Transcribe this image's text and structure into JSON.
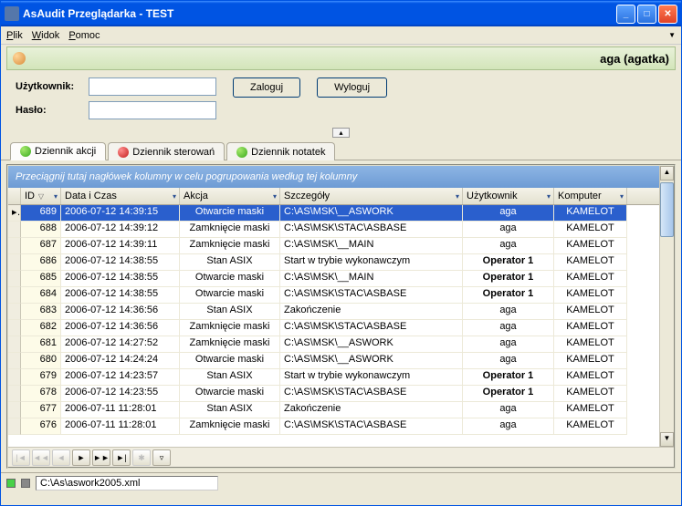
{
  "window": {
    "title": "AsAudit Przeglądarka - TEST"
  },
  "menu": {
    "file": "Plik",
    "view": "Widok",
    "help": "Pomoc"
  },
  "userbar": {
    "display": "aga (agatka)"
  },
  "login": {
    "user_label": "Użytkownik:",
    "pass_label": "Hasło:",
    "user_value": "",
    "pass_value": "",
    "login_btn": "Zaloguj",
    "logout_btn": "Wyloguj"
  },
  "tabs": {
    "actions": "Dziennik akcji",
    "controls": "Dziennik sterowań",
    "notes": "Dziennik notatek"
  },
  "grid": {
    "group_hint": "Przeciągnij tutaj nagłówek kolumny w celu pogrupowania według tej kolumny",
    "cols": {
      "id": "ID",
      "dt": "Data i Czas",
      "action": "Akcja",
      "details": "Szczegóły",
      "user": "Użytkownik",
      "computer": "Komputer"
    },
    "rows": [
      {
        "id": "689",
        "dt": "2006-07-12 14:39:15",
        "action": "Otwarcie maski",
        "details": "C:\\AS\\MSK\\__ASWORK",
        "user": "aga",
        "computer": "KAMELOT",
        "selected": true
      },
      {
        "id": "688",
        "dt": "2006-07-12 14:39:12",
        "action": "Zamknięcie maski",
        "details": "C:\\AS\\MSK\\STAC\\ASBASE",
        "user": "aga",
        "computer": "KAMELOT"
      },
      {
        "id": "687",
        "dt": "2006-07-12 14:39:11",
        "action": "Zamknięcie maski",
        "details": "C:\\AS\\MSK\\__MAIN",
        "user": "aga",
        "computer": "KAMELOT"
      },
      {
        "id": "686",
        "dt": "2006-07-12 14:38:55",
        "action": "Stan ASIX",
        "details": "Start w trybie wykonawczym",
        "user": "Operator 1",
        "ubold": true,
        "computer": "KAMELOT"
      },
      {
        "id": "685",
        "dt": "2006-07-12 14:38:55",
        "action": "Otwarcie maski",
        "details": "C:\\AS\\MSK\\__MAIN",
        "user": "Operator 1",
        "ubold": true,
        "computer": "KAMELOT"
      },
      {
        "id": "684",
        "dt": "2006-07-12 14:38:55",
        "action": "Otwarcie maski",
        "details": "C:\\AS\\MSK\\STAC\\ASBASE",
        "user": "Operator 1",
        "ubold": true,
        "computer": "KAMELOT"
      },
      {
        "id": "683",
        "dt": "2006-07-12 14:36:56",
        "action": "Stan ASIX",
        "details": "Zakończenie",
        "user": "aga",
        "computer": "KAMELOT"
      },
      {
        "id": "682",
        "dt": "2006-07-12 14:36:56",
        "action": "Zamknięcie maski",
        "details": "C:\\AS\\MSK\\STAC\\ASBASE",
        "user": "aga",
        "computer": "KAMELOT"
      },
      {
        "id": "681",
        "dt": "2006-07-12 14:27:52",
        "action": "Zamknięcie maski",
        "details": "C:\\AS\\MSK\\__ASWORK",
        "user": "aga",
        "computer": "KAMELOT"
      },
      {
        "id": "680",
        "dt": "2006-07-12 14:24:24",
        "action": "Otwarcie maski",
        "details": "C:\\AS\\MSK\\__ASWORK",
        "user": "aga",
        "computer": "KAMELOT"
      },
      {
        "id": "679",
        "dt": "2006-07-12 14:23:57",
        "action": "Stan ASIX",
        "details": "Start w trybie wykonawczym",
        "user": "Operator 1",
        "ubold": true,
        "computer": "KAMELOT"
      },
      {
        "id": "678",
        "dt": "2006-07-12 14:23:55",
        "action": "Otwarcie maski",
        "details": "C:\\AS\\MSK\\STAC\\ASBASE",
        "user": "Operator 1",
        "ubold": true,
        "computer": "KAMELOT"
      },
      {
        "id": "677",
        "dt": "2006-07-11 11:28:01",
        "action": "Stan ASIX",
        "details": "Zakończenie",
        "user": "aga",
        "computer": "KAMELOT"
      },
      {
        "id": "676",
        "dt": "2006-07-11 11:28:01",
        "action": "Zamknięcie maski",
        "details": "C:\\AS\\MSK\\STAC\\ASBASE",
        "user": "aga",
        "computer": "KAMELOT"
      }
    ]
  },
  "status": {
    "path": "C:\\As\\aswork2005.xml"
  }
}
